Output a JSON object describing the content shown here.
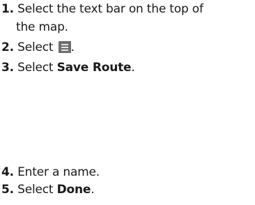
{
  "steps": [
    {
      "number": "1.",
      "text": "Select the text bar on the top of",
      "continuation": "the map."
    },
    {
      "number": "2.",
      "text_before": "Select",
      "icon": "menu-icon",
      "text_after": "."
    },
    {
      "number": "3.",
      "text_before": "Select",
      "strong": "Save Route",
      "text_after": "."
    },
    {
      "number": "4.",
      "text": "Enter a name."
    },
    {
      "number": "5.",
      "text_before": "Select",
      "strong": "Done",
      "text_after": "."
    }
  ]
}
